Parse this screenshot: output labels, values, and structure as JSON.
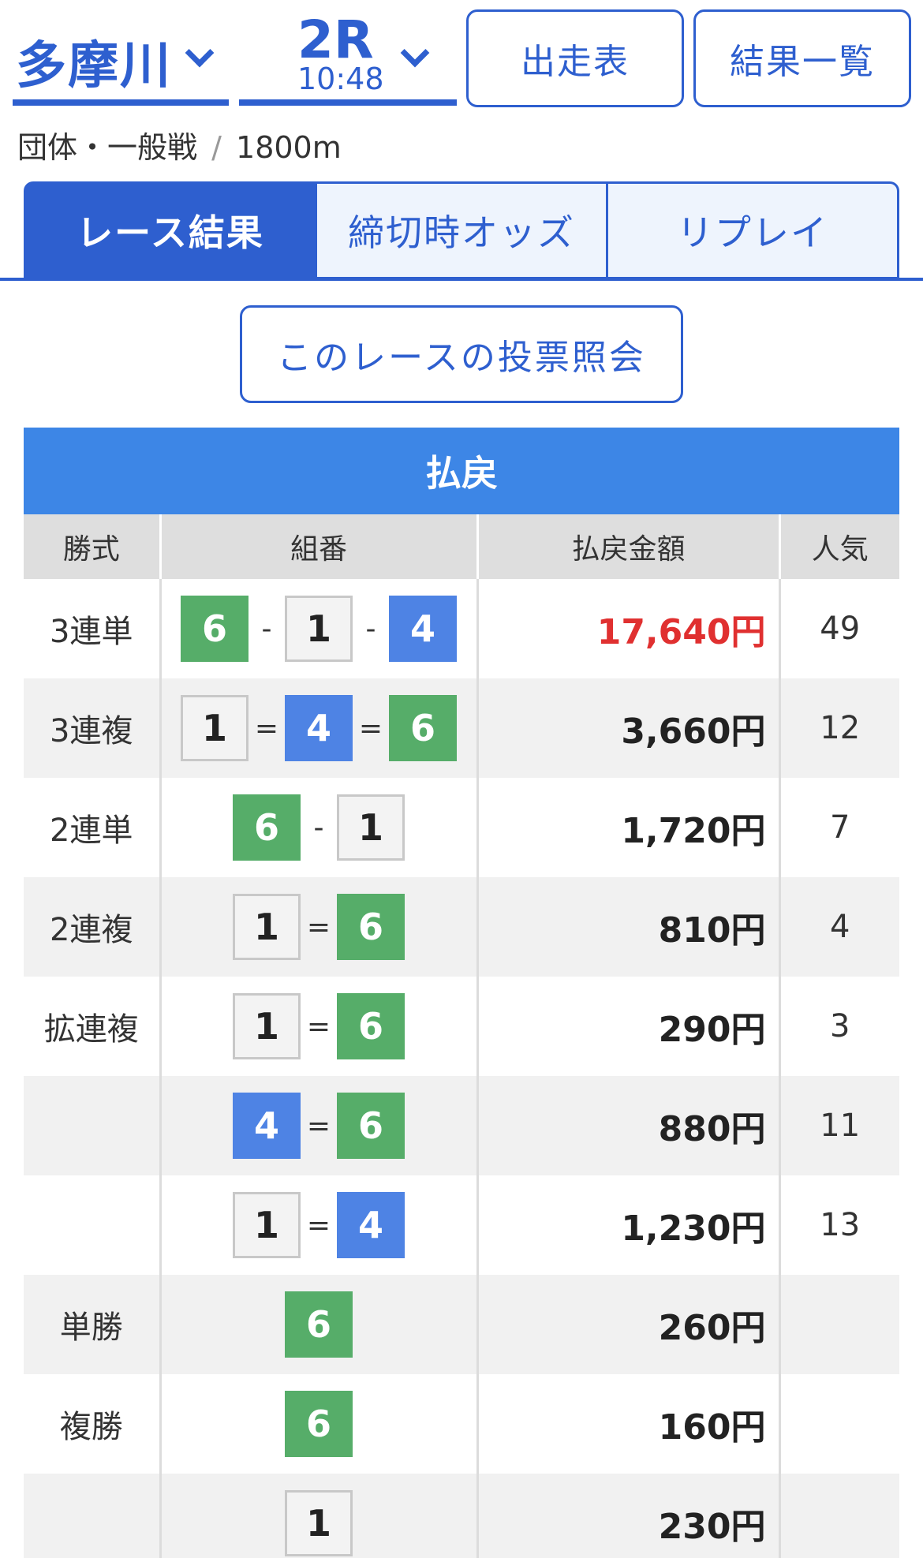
{
  "header": {
    "venue": "多摩川",
    "race_number": "2R",
    "race_time": "10:48",
    "entries_button": "出走表",
    "results_button": "結果一覧"
  },
  "race_info": {
    "type": "団体・一般戦",
    "separator": "/",
    "distance": "1800m"
  },
  "tabs": [
    {
      "label": "レース結果",
      "active": true
    },
    {
      "label": "締切時オッズ",
      "active": false
    },
    {
      "label": "リプレイ",
      "active": false
    }
  ],
  "inquiry_button": "このレースの投票照会",
  "payout": {
    "title": "払戻",
    "headers": [
      "勝式",
      "組番",
      "払戻金額",
      "人気"
    ],
    "colors": {
      "green": "#56ad69",
      "blue": "#4e83e4",
      "white": "#f3f3f3",
      "highlight": "#e03030"
    },
    "rows": [
      {
        "type": "3連単",
        "nums": [
          "6",
          "1",
          "4"
        ],
        "styles": [
          "g",
          "w",
          "b"
        ],
        "sep": "-",
        "amount": "17,640円",
        "popularity": "49",
        "highlight": true
      },
      {
        "type": "3連複",
        "nums": [
          "1",
          "4",
          "6"
        ],
        "styles": [
          "w",
          "b",
          "g"
        ],
        "sep": "=",
        "amount": "3,660円",
        "popularity": "12"
      },
      {
        "type": "2連単",
        "nums": [
          "6",
          "1"
        ],
        "styles": [
          "g",
          "w"
        ],
        "sep": "-",
        "amount": "1,720円",
        "popularity": "7"
      },
      {
        "type": "2連複",
        "nums": [
          "1",
          "6"
        ],
        "styles": [
          "w",
          "g"
        ],
        "sep": "=",
        "amount": "810円",
        "popularity": "4"
      },
      {
        "type": "拡連複",
        "nums": [
          "1",
          "6"
        ],
        "styles": [
          "w",
          "g"
        ],
        "sep": "=",
        "amount": "290円",
        "popularity": "3"
      },
      {
        "type": "",
        "nums": [
          "4",
          "6"
        ],
        "styles": [
          "b",
          "g"
        ],
        "sep": "=",
        "amount": "880円",
        "popularity": "11"
      },
      {
        "type": "",
        "nums": [
          "1",
          "4"
        ],
        "styles": [
          "w",
          "b"
        ],
        "sep": "=",
        "amount": "1,230円",
        "popularity": "13"
      },
      {
        "type": "単勝",
        "nums": [
          "6"
        ],
        "styles": [
          "g"
        ],
        "sep": "",
        "amount": "260円",
        "popularity": ""
      },
      {
        "type": "複勝",
        "nums": [
          "6"
        ],
        "styles": [
          "g"
        ],
        "sep": "",
        "amount": "160円",
        "popularity": ""
      },
      {
        "type": "",
        "nums": [
          "1"
        ],
        "styles": [
          "w"
        ],
        "sep": "",
        "amount": "230円",
        "popularity": ""
      }
    ]
  }
}
